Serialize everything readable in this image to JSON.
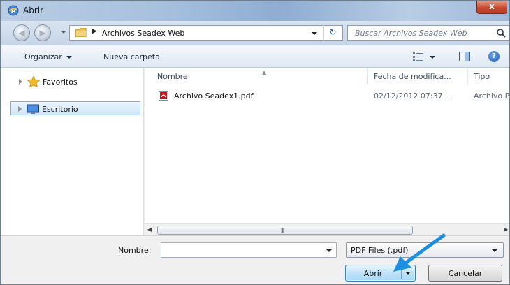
{
  "window": {
    "title": "Abrir",
    "close_symbol": "x"
  },
  "addressbar": {
    "back_symbol": "◀",
    "forward_symbol": "▶",
    "path_arrow": "▶",
    "path": "Archivos Seadex Web",
    "refresh_symbol": "↻",
    "search_placeholder": "Buscar Archivos Seadex Web"
  },
  "toolbar": {
    "organize_label": "Organizar",
    "new_folder_label": "Nueva carpeta",
    "help_symbol": "?"
  },
  "nav": {
    "items": [
      {
        "label": "Favoritos",
        "icon": "star-icon"
      },
      {
        "label": "Escritorio",
        "icon": "desktop-icon",
        "selected": true
      }
    ]
  },
  "filelist": {
    "columns": {
      "name": "Nombre",
      "date": "Fecha de modifica...",
      "type": "Tipo"
    },
    "sort_symbol": "▲",
    "rows": [
      {
        "name": "Archivo Seadex1.pdf",
        "date": "02/12/2012 07:37 ...",
        "type": "Archivo P",
        "icon": "pdf-icon"
      }
    ],
    "scroll_left": "◀",
    "scroll_grip": "III",
    "scroll_right": "▶"
  },
  "footer": {
    "name_label": "Nombre:",
    "name_value": "",
    "filter_value": "PDF Files (.pdf)",
    "open_label": "Abrir",
    "cancel_label": "Cancelar"
  },
  "colors": {
    "annotation_arrow": "#1d8fe0",
    "accent": "#3c7fb1"
  }
}
